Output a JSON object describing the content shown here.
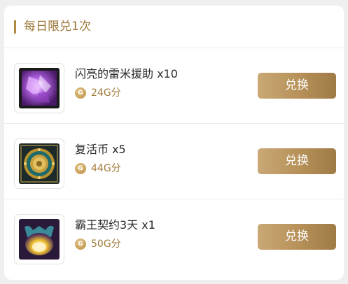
{
  "section": {
    "title": "每日限兑1次"
  },
  "currency_symbol": "G",
  "items": [
    {
      "name": "闪亮的雷米援助 x10",
      "price": "24G分",
      "button": "兑换",
      "icon": "purple-crystal-icon"
    },
    {
      "name": "复活币 x5",
      "price": "44G分",
      "button": "兑换",
      "icon": "revive-coin-icon"
    },
    {
      "name": "霸王契约3天 x1",
      "price": "50G分",
      "button": "兑换",
      "icon": "overlord-contract-icon"
    }
  ],
  "colors": {
    "accent": "#b08a3e",
    "button": "#b8925a",
    "price": "#a07a38"
  }
}
